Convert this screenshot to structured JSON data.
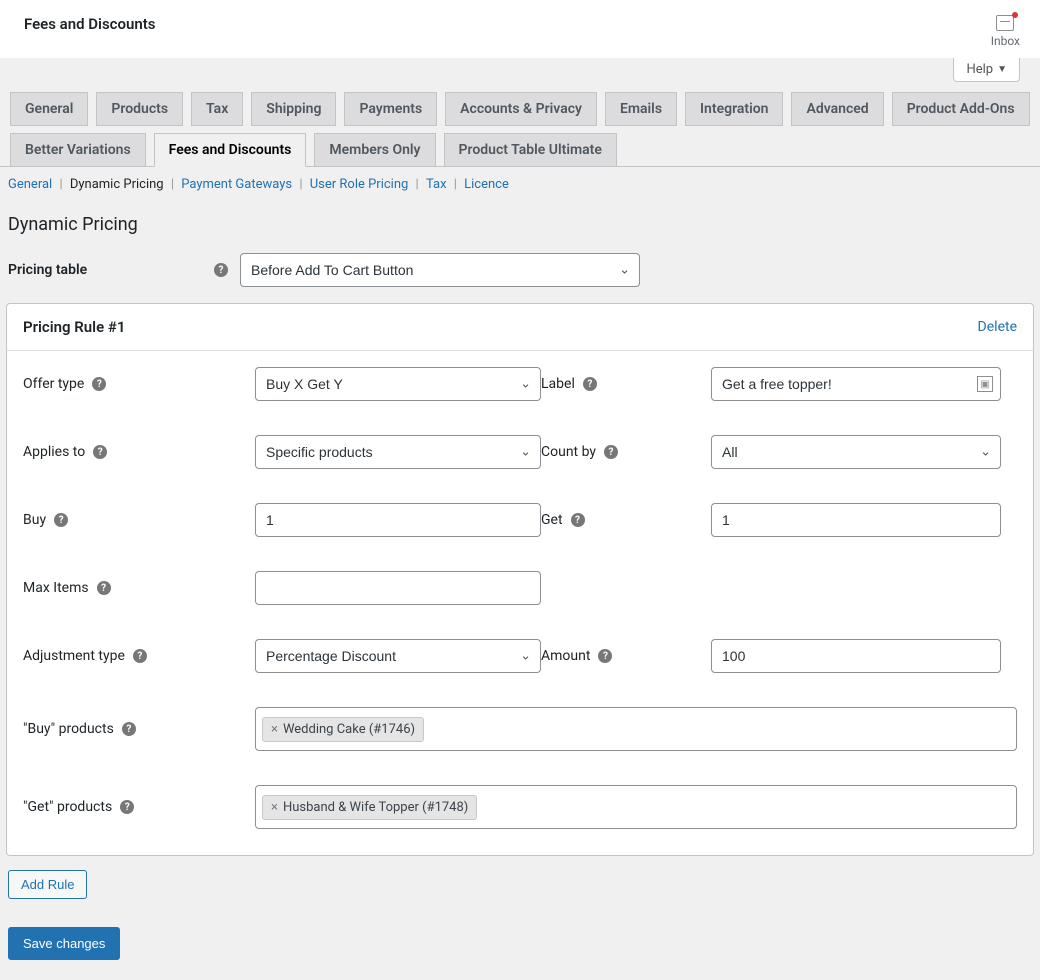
{
  "header": {
    "title": "Fees and Discounts",
    "inbox_label": "Inbox"
  },
  "help_label": "Help",
  "primary_tabs": [
    "General",
    "Products",
    "Tax",
    "Shipping",
    "Payments",
    "Accounts & Privacy",
    "Emails",
    "Integration",
    "Advanced",
    "Product Add-Ons",
    "Better Variations",
    "Fees and Discounts",
    "Members Only",
    "Product Table Ultimate"
  ],
  "primary_tab_active": "Fees and Discounts",
  "sub_nav": {
    "items": [
      "General",
      "Dynamic Pricing",
      "Payment Gateways",
      "User Role Pricing",
      "Tax",
      "Licence"
    ],
    "current": "Dynamic Pricing"
  },
  "section_title": "Dynamic Pricing",
  "pricing_table": {
    "label": "Pricing table",
    "value": "Before Add To Cart Button"
  },
  "rule": {
    "title": "Pricing Rule #1",
    "delete_label": "Delete",
    "offer_type": {
      "label": "Offer type",
      "value": "Buy X Get Y"
    },
    "label_field": {
      "label": "Label",
      "value": "Get a free topper!"
    },
    "applies_to": {
      "label": "Applies to",
      "value": "Specific products"
    },
    "count_by": {
      "label": "Count by",
      "value": "All"
    },
    "buy": {
      "label": "Buy",
      "value": "1"
    },
    "get": {
      "label": "Get",
      "value": "1"
    },
    "max_items": {
      "label": "Max Items",
      "value": ""
    },
    "adjustment_type": {
      "label": "Adjustment type",
      "value": "Percentage Discount"
    },
    "amount": {
      "label": "Amount",
      "value": "100"
    },
    "buy_products": {
      "label": "\"Buy\" products",
      "tokens": [
        "Wedding Cake (#1746)"
      ]
    },
    "get_products": {
      "label": "\"Get\" products",
      "tokens": [
        "Husband & Wife Topper (#1748)"
      ]
    }
  },
  "add_rule_label": "Add Rule",
  "save_label": "Save changes"
}
